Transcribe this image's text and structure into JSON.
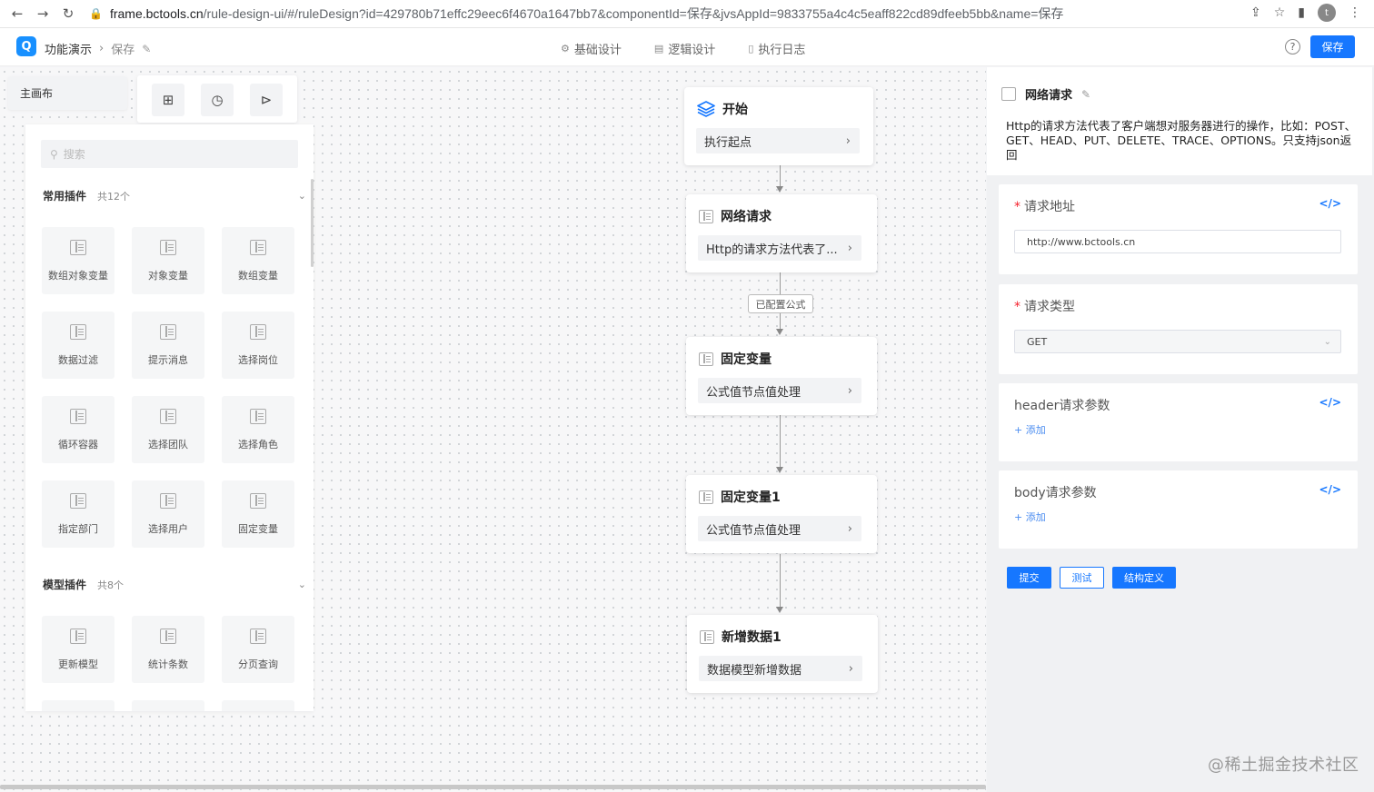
{
  "browser": {
    "url_host": "frame.bctools.cn",
    "url_path": "/rule-design-ui/#/ruleDesign?id=429780b71effc29eec6f4670a1647bb7&componentId=保存&jvsAppId=9833755a4c4c5eaff822cd89dfeeb5bb&name=保存",
    "profile_initial": "t"
  },
  "header": {
    "breadcrumb_root": "功能演示",
    "breadcrumb_current": "保存",
    "tabs": [
      {
        "label": "基础设计",
        "icon": "gear-icon"
      },
      {
        "label": "逻辑设计",
        "icon": "logic-icon"
      },
      {
        "label": "执行日志",
        "icon": "log-icon"
      }
    ],
    "save_label": "保存",
    "accent": "#1677ff"
  },
  "canvas": {
    "main_tab": "主画布"
  },
  "plugins": {
    "search_placeholder": "搜索",
    "common": {
      "title": "常用插件",
      "count": "共12个",
      "items": [
        "数组对象变量",
        "对象变量",
        "数组变量",
        "数据过滤",
        "提示消息",
        "选择岗位",
        "循环容器",
        "选择团队",
        "选择角色",
        "指定部门",
        "选择用户",
        "固定变量"
      ]
    },
    "model": {
      "title": "模型插件",
      "count": "共8个",
      "items": [
        "更新模型",
        "统计条数",
        "分页查询"
      ]
    }
  },
  "flow": {
    "nodes": [
      {
        "title": "开始",
        "body": "执行起点",
        "icon": "layers-icon"
      },
      {
        "title": "网络请求",
        "body": "Http的请求方法代表了...",
        "icon": "form-icon"
      },
      {
        "title": "固定变量",
        "body": "公式值节点值处理",
        "icon": "form-icon"
      },
      {
        "title": "固定变量1",
        "body": "公式值节点值处理",
        "icon": "form-icon"
      },
      {
        "title": "新增数据1",
        "body": "数据模型新增数据",
        "icon": "form-icon"
      }
    ],
    "edge_label": "已配置公式"
  },
  "detail": {
    "title": "网络请求",
    "description": "Http的请求方法代表了客户端想对服务器进行的操作，比如：POST、GET、HEAD、PUT、DELETE、TRACE、OPTIONS。只支持json返回",
    "url_label": "请求地址",
    "url_value": "http://www.bctools.cn",
    "method_label": "请求类型",
    "method_value": "GET",
    "header_label": "header请求参数",
    "header_add": "添加",
    "body_label": "body请求参数",
    "body_add": "添加",
    "submit": "提交",
    "test": "测试",
    "struct": "结构定义"
  },
  "footer_signature": "@稀土掘金技术社区"
}
